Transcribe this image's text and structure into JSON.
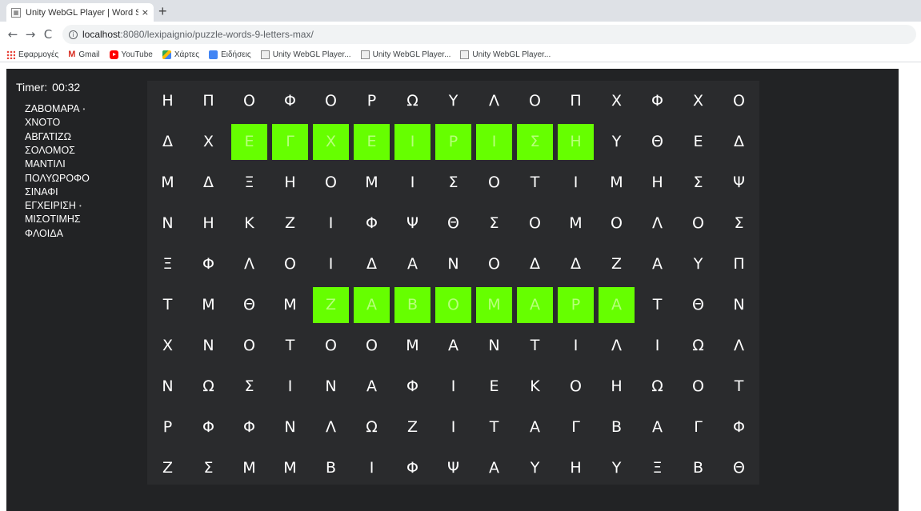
{
  "browser": {
    "tab_title": "Unity WebGL Player | Word Searc",
    "tab_close": "×",
    "new_tab": "+",
    "nav": {
      "back": "←",
      "forward": "→",
      "reload": "C"
    },
    "url_host": "localhost",
    "url_rest": ":8080/lexipaignio/puzzle-words-9-letters-max/",
    "bookmarks": [
      {
        "icon": "apps-icon",
        "label": "Εφαρμογές"
      },
      {
        "icon": "gmail-icon",
        "label": "Gmail"
      },
      {
        "icon": "youtube-icon",
        "label": "YouTube"
      },
      {
        "icon": "maps-icon",
        "label": "Χάρτες"
      },
      {
        "icon": "news-icon",
        "label": "Ειδήσεις"
      },
      {
        "icon": "unity-icon",
        "label": "Unity WebGL Player..."
      },
      {
        "icon": "unity-icon",
        "label": "Unity WebGL Player..."
      },
      {
        "icon": "unity-icon",
        "label": "Unity WebGL Player..."
      }
    ]
  },
  "game": {
    "timer_label": "Timer:",
    "timer_value": "00:32",
    "found_color": "#66ff00",
    "words": [
      {
        "text": "ΖΑΒΟΜΑΡΑ",
        "found": true
      },
      {
        "text": "ΧΝΟΤΟ",
        "found": false
      },
      {
        "text": "ΑΒΓΑΤΙΖΩ",
        "found": false
      },
      {
        "text": "ΣΟΛΟΜΟΣ",
        "found": false
      },
      {
        "text": "ΜΑΝΤΙΛΙ",
        "found": false
      },
      {
        "text": "ΠΟΛΥΩΡΟΦΟ",
        "found": false
      },
      {
        "text": "ΣΙΝΑΦΙ",
        "found": false
      },
      {
        "text": "ΕΓΧΕΙΡΙΣΗ",
        "found": true
      },
      {
        "text": "ΜΙΣΟΤΙΜΗΣ",
        "found": false
      },
      {
        "text": "ΦΛΟΙΔΑ",
        "found": false
      }
    ],
    "grid": [
      [
        "Η",
        "Π",
        "Ο",
        "Φ",
        "Ο",
        "Ρ",
        "Ω",
        "Υ",
        "Λ",
        "Ο",
        "Π",
        "Χ",
        "Φ",
        "Χ",
        "Ο"
      ],
      [
        "Δ",
        "Χ",
        "Ε",
        "Γ",
        "Χ",
        "Ε",
        "Ι",
        "Ρ",
        "Ι",
        "Σ",
        "Η",
        "Υ",
        "Θ",
        "Ε",
        "Δ"
      ],
      [
        "Μ",
        "Δ",
        "Ξ",
        "Η",
        "Ο",
        "Μ",
        "Ι",
        "Σ",
        "Ο",
        "Τ",
        "Ι",
        "Μ",
        "Η",
        "Σ",
        "Ψ"
      ],
      [
        "Ν",
        "Η",
        "Κ",
        "Ζ",
        "Ι",
        "Φ",
        "Ψ",
        "Θ",
        "Σ",
        "Ο",
        "Μ",
        "Ο",
        "Λ",
        "Ο",
        "Σ"
      ],
      [
        "Ξ",
        "Φ",
        "Λ",
        "Ο",
        "Ι",
        "Δ",
        "Α",
        "Ν",
        "Ο",
        "Δ",
        "Δ",
        "Ζ",
        "Α",
        "Υ",
        "Π"
      ],
      [
        "Τ",
        "Μ",
        "Θ",
        "Μ",
        "Ζ",
        "Α",
        "Β",
        "Ο",
        "Μ",
        "Α",
        "Ρ",
        "Α",
        "Τ",
        "Θ",
        "Ν"
      ],
      [
        "Χ",
        "Ν",
        "Ο",
        "Τ",
        "Ο",
        "Ο",
        "Μ",
        "Α",
        "Ν",
        "Τ",
        "Ι",
        "Λ",
        "Ι",
        "Ω",
        "Λ"
      ],
      [
        "Ν",
        "Ω",
        "Σ",
        "Ι",
        "Ν",
        "Α",
        "Φ",
        "Ι",
        "Ε",
        "Κ",
        "Ο",
        "Η",
        "Ω",
        "Ο",
        "Τ"
      ],
      [
        "Ρ",
        "Φ",
        "Φ",
        "Ν",
        "Λ",
        "Ω",
        "Ζ",
        "Ι",
        "Τ",
        "Α",
        "Γ",
        "Β",
        "Α",
        "Γ",
        "Φ"
      ],
      [
        "Ζ",
        "Σ",
        "Μ",
        "Μ",
        "Β",
        "Ι",
        "Φ",
        "Ψ",
        "Α",
        "Υ",
        "Η",
        "Υ",
        "Ξ",
        "Β",
        "Θ"
      ]
    ],
    "found_cells": [
      [
        1,
        2
      ],
      [
        1,
        3
      ],
      [
        1,
        4
      ],
      [
        1,
        5
      ],
      [
        1,
        6
      ],
      [
        1,
        7
      ],
      [
        1,
        8
      ],
      [
        1,
        9
      ],
      [
        1,
        10
      ],
      [
        5,
        4
      ],
      [
        5,
        5
      ],
      [
        5,
        6
      ],
      [
        5,
        7
      ],
      [
        5,
        8
      ],
      [
        5,
        9
      ],
      [
        5,
        10
      ],
      [
        5,
        11
      ]
    ]
  }
}
